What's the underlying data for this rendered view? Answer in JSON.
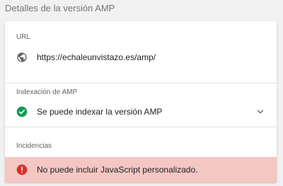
{
  "page": {
    "title": "Detalles de la versión AMP"
  },
  "url_section": {
    "label": "URL",
    "icon": "globe-icon",
    "value": "https://echaleunvistazo.es/amp/"
  },
  "indexing_section": {
    "label": "Indexación de AMP",
    "icon": "check-circle-icon",
    "status": "Se puede indexar la versión AMP",
    "status_color": "#0f9d58"
  },
  "issues_section": {
    "label": "Incidencias",
    "icon": "error-icon",
    "items": [
      {
        "text": "No puede incluir JavaScript personalizado.",
        "color": "#d93025",
        "background": "#f4c7c3"
      }
    ]
  }
}
